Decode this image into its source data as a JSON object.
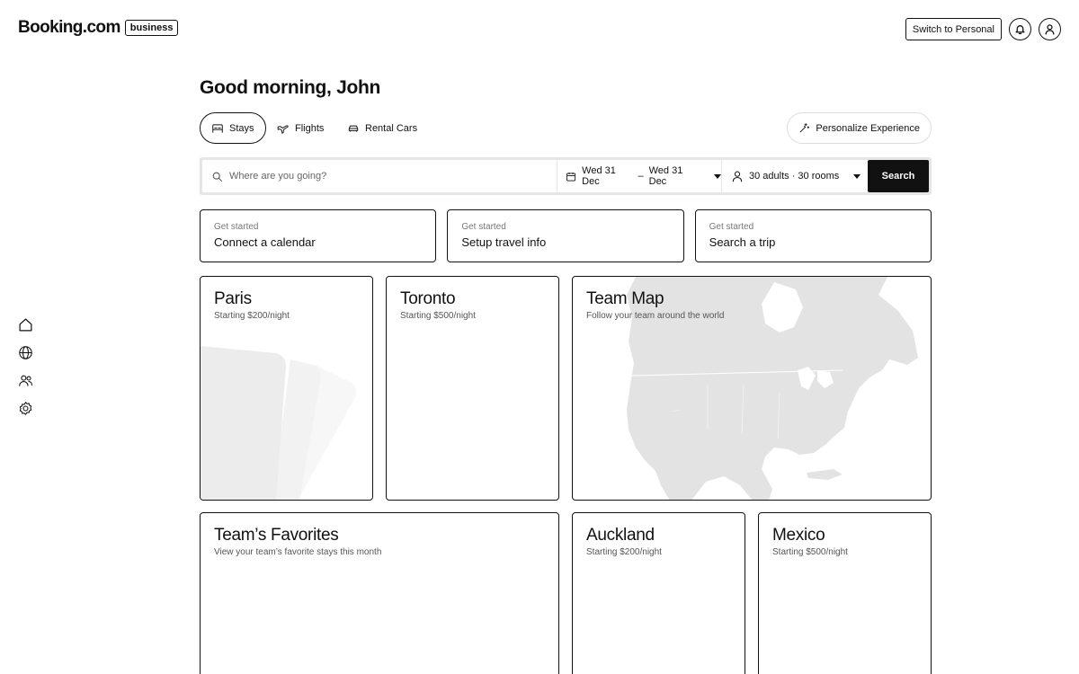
{
  "header": {
    "logo_text": "Booking.com",
    "logo_badge": "business",
    "switch_label": "Switch to Personal"
  },
  "icons": {
    "bell": "bell-icon",
    "profile": "user-icon",
    "home": "home-icon",
    "globe": "globe-icon",
    "team": "team-icon",
    "settings": "settings-icon"
  },
  "main": {
    "greeting": "Good morning, John",
    "tabs": [
      {
        "label": "Stays",
        "active": true
      },
      {
        "label": "Flights",
        "active": false
      },
      {
        "label": "Rental Cars",
        "active": false
      }
    ],
    "personalize_label": "Personalize Experience",
    "search": {
      "destination_placeholder": "Where are you going?",
      "date_start": "Wed 31 Dec",
      "date_separator": "–",
      "date_end": "Wed 31 Dec",
      "guests": "30 adults · 30 rooms",
      "button_label": "Search"
    },
    "get_started": [
      {
        "kicker": "Get started",
        "title": "Connect a calendar"
      },
      {
        "kicker": "Get started",
        "title": "Setup travel info"
      },
      {
        "kicker": "Get started",
        "title": "Search a trip"
      }
    ],
    "cards": {
      "paris": {
        "title": "Paris",
        "subtitle": "Starting $200/night"
      },
      "toronto": {
        "title": "Toronto",
        "subtitle": "Starting $500/night"
      },
      "team_map": {
        "title": "Team Map",
        "subtitle": "Follow your team around the world"
      },
      "favorites": {
        "title": "Team’s Favorites",
        "subtitle": "View your team’s favorite stays this month"
      },
      "auckland": {
        "title": "Auckland",
        "subtitle": "Starting $200/night"
      },
      "mexico": {
        "title": "Mexico",
        "subtitle": "Starting $500/night"
      }
    }
  },
  "colors": {
    "text": "#111111",
    "muted": "#777777",
    "search_frame": "#e6e6e6",
    "map_land": "#e3e3e3",
    "deco_1": "#ececec",
    "deco_2": "#f2f2f2",
    "deco_3": "#f7f7f7"
  }
}
